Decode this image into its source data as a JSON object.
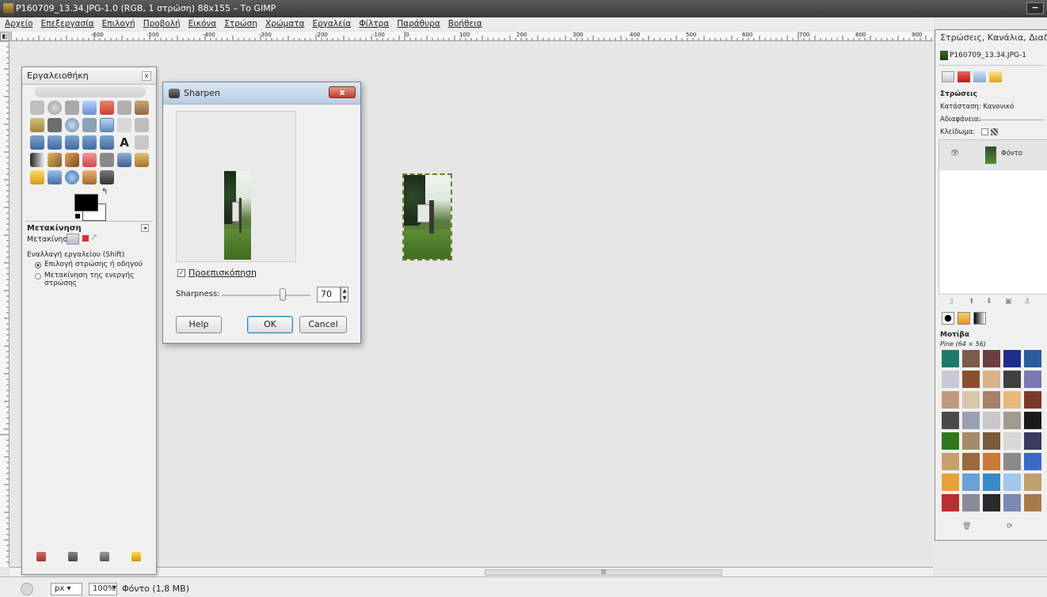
{
  "window": {
    "title": "P160709_13.34.JPG-1.0 (RGB, 1 στρώση) 88x155 – Το GIMP",
    "minimize_label": "−"
  },
  "menu": [
    "Αρχείο",
    "Επεξεργασία",
    "Επιλογή",
    "Προβολή",
    "Εικόνα",
    "Στρώση",
    "Χρώματα",
    "Εργαλεία",
    "Φίλτρα",
    "Παράθυρα",
    "Βοήθεια"
  ],
  "ruler": {
    "labels": [
      "-600",
      "-500",
      "-400",
      "-300",
      "-200",
      "-100",
      "0",
      "100",
      "200",
      "300",
      "400",
      "500",
      "600",
      "700",
      "800",
      "900"
    ]
  },
  "toolbox": {
    "title": "Εργαλειοθήκη",
    "close_label": "x",
    "tool_options_title": "Μετακίνηση",
    "move_label": "Μετακίνηση:",
    "toggle_label": "Εναλλαγή εργαλείου (Shift)",
    "radio_1": "Επιλογή στρώσης ή οδηγού",
    "radio_2": "Μετακίνηση της ενεργής στρώσης"
  },
  "dialog": {
    "title": "Sharpen",
    "close_label": "x",
    "preview_label": "Προεπισκόπηση",
    "preview_checked": true,
    "sharpness_label": "Sharpness:",
    "sharpness_value": "70",
    "sharpness_fraction": 0.7,
    "help_label": "Help",
    "ok_label": "OK",
    "cancel_label": "Cancel"
  },
  "dock": {
    "title": "Στρώσεις, Κανάλια, Διαδρομ",
    "image_name": "P160709_13.34.JPG-1",
    "layers_heading": "Στρώσεις",
    "mode_label": "Κατάσταση: Κανονικό",
    "opacity_label": "Αδιαφάνεια:",
    "lock_label": "Κλείδωμα:",
    "layer_name": "Φόντο",
    "patterns_heading": "Μοτίβα",
    "pattern_name": "Pine (64 × 56)"
  },
  "statusbar": {
    "unit": "px",
    "zoom": "100%",
    "info": "Φόντο (1,8 MB)"
  },
  "colors": {
    "fg": "#000000",
    "bg": "#ffffff",
    "selection": "#6b7d2a"
  }
}
